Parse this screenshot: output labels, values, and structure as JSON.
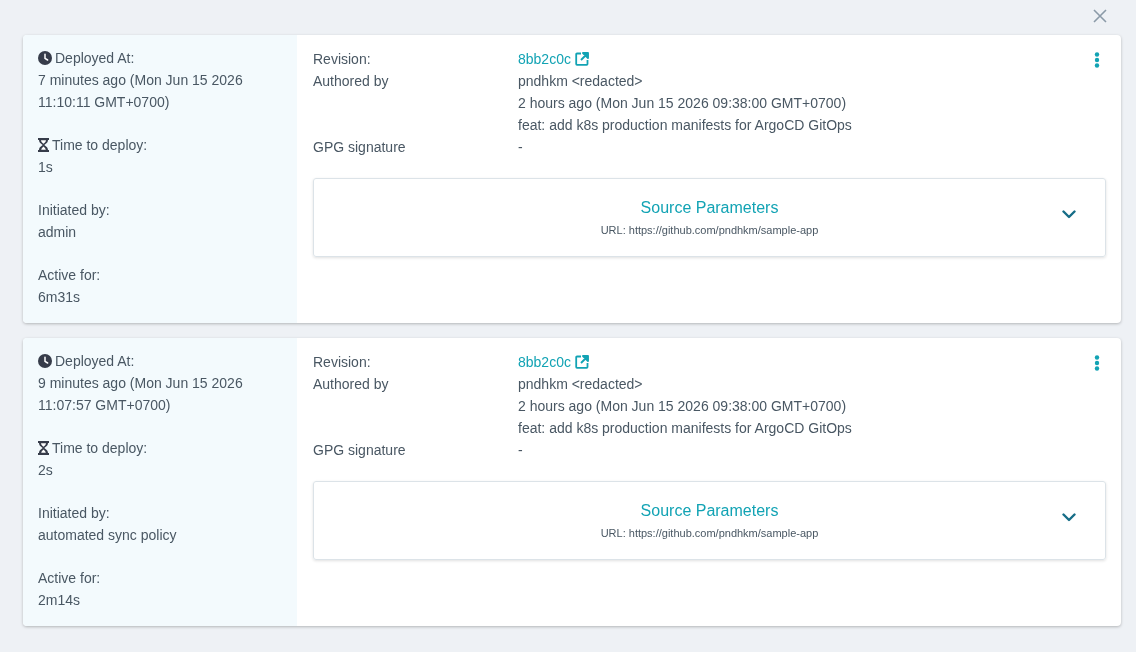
{
  "deployments": [
    {
      "info": [
        {
          "kind": "clock",
          "label": "Deployed At:",
          "value": "7 minutes ago (Mon Jun 15 2026 11:10:11 GMT+0700)"
        },
        {
          "kind": "hourglass",
          "label": "Time to deploy:",
          "value": "1s"
        },
        {
          "kind": "plain",
          "label": "Initiated by:",
          "value": "admin"
        },
        {
          "kind": "plain",
          "label": "Active for:",
          "value": "6m31s"
        }
      ],
      "details": [
        {
          "kind": "link",
          "label": "Revision:",
          "values": [
            "8bb2c0c"
          ]
        },
        {
          "kind": "text",
          "label": "Authored by",
          "values": [
            "pndhkm <redacted>",
            "2 hours ago (Mon Jun 15 2026 09:38:00 GMT+0700)",
            "feat: add k8s production manifests for ArgoCD GitOps"
          ]
        },
        {
          "kind": "text",
          "label": "GPG signature",
          "values": [
            "-"
          ]
        }
      ],
      "source_parameters": {
        "title": "Source Parameters",
        "url": "URL: https://github.com/pndhkm/sample-app",
        "expanded": false
      }
    },
    {
      "info": [
        {
          "kind": "clock",
          "label": "Deployed At:",
          "value": "9 minutes ago (Mon Jun 15 2026 11:07:57 GMT+0700)"
        },
        {
          "kind": "hourglass",
          "label": "Time to deploy:",
          "value": "2s"
        },
        {
          "kind": "plain",
          "label": "Initiated by:",
          "value": "automated sync policy"
        },
        {
          "kind": "plain",
          "label": "Active for:",
          "value": "2m14s"
        }
      ],
      "details": [
        {
          "kind": "link",
          "label": "Revision:",
          "values": [
            "8bb2c0c"
          ]
        },
        {
          "kind": "text",
          "label": "Authored by",
          "values": [
            "pndhkm <redacted>",
            "2 hours ago (Mon Jun 15 2026 09:38:00 GMT+0700)",
            "feat: add k8s production manifests for ArgoCD GitOps"
          ]
        },
        {
          "kind": "text",
          "label": "GPG signature",
          "values": [
            "-"
          ]
        }
      ],
      "source_parameters": {
        "title": "Source Parameters",
        "url": "URL: https://github.com/pndhkm/sample-app",
        "expanded": false
      }
    }
  ]
}
